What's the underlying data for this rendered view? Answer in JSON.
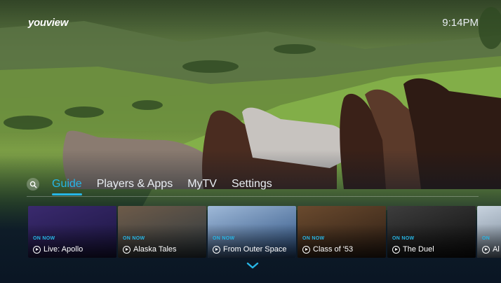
{
  "header": {
    "logo": "youview",
    "time": "9:14PM"
  },
  "nav": {
    "items": [
      {
        "label": "Guide",
        "active": true
      },
      {
        "label": "Players & Apps",
        "active": false
      },
      {
        "label": "MyTV",
        "active": false
      },
      {
        "label": "Settings",
        "active": false
      }
    ]
  },
  "rail": {
    "tiles": [
      {
        "badge": "ON NOW",
        "title": "Live: Apollo",
        "colors": [
          "#3a2a6e",
          "#1b1540"
        ]
      },
      {
        "badge": "ON NOW",
        "title": "Alaska Tales",
        "colors": [
          "#6e5b49",
          "#2f3a40"
        ]
      },
      {
        "badge": "ON NOW",
        "title": "From Outer Space",
        "colors": [
          "#9fb9d8",
          "#2a4f80"
        ]
      },
      {
        "badge": "ON NOW",
        "title": "Class of '53",
        "colors": [
          "#6a4a2e",
          "#2d1e14"
        ]
      },
      {
        "badge": "ON NOW",
        "title": "The Duel",
        "colors": [
          "#3d3d3d",
          "#0e0e0e"
        ]
      },
      {
        "badge": "ON",
        "title": "Al",
        "colors": [
          "#c8d3df",
          "#5a6b7c"
        ]
      }
    ]
  },
  "colors": {
    "accent": "#27b6e6",
    "text": "#e9eef3"
  }
}
